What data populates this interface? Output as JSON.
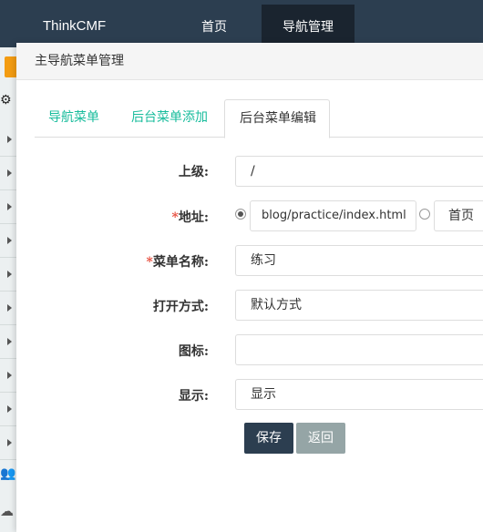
{
  "topbar": {
    "brand": "ThinkCMF",
    "nav": [
      {
        "label": "首页"
      },
      {
        "label": "导航管理",
        "active": true
      }
    ],
    "bg_color": "#2c3e50"
  },
  "sidebar": {
    "icons": [
      "orange-tag-icon",
      "gears-icon",
      "users-icon",
      "cloud-icon"
    ]
  },
  "panel": {
    "title": "主导航菜单管理",
    "tabs": [
      {
        "label": "导航菜单"
      },
      {
        "label": "后台菜单添加"
      },
      {
        "label": "后台菜单编辑",
        "active": true
      }
    ]
  },
  "form": {
    "parent_label": "上级:",
    "parent_value": "/",
    "address_required": "*",
    "address_label": "地址:",
    "address_url": "blog/practice/index.html",
    "address_option2": "首页",
    "name_required": "*",
    "name_label": "菜单名称:",
    "name_value": "练习",
    "open_label": "打开方式:",
    "open_value": "默认方式",
    "icon_label": "图标:",
    "icon_value": "",
    "display_label": "显示:",
    "display_value": "显示",
    "save_label": "保存",
    "back_label": "返回"
  },
  "colors": {
    "accent": "#18bc9c",
    "primary": "#2c3e50",
    "secondary": "#95a5a6",
    "required": "#e74c3c"
  }
}
